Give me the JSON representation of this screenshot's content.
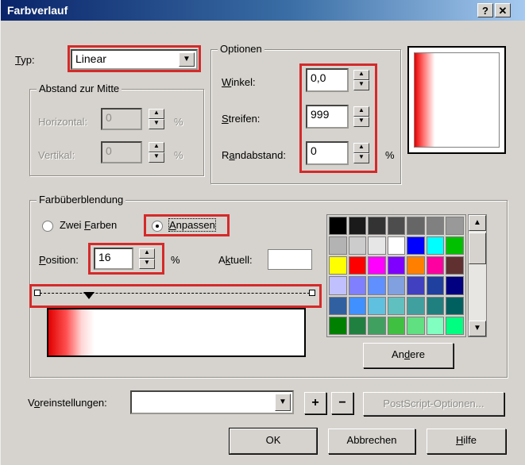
{
  "window": {
    "title": "Farbverlauf",
    "help_label": "?",
    "close_label": "✕"
  },
  "typ": {
    "label_pre": "",
    "label_u": "T",
    "label_post": "yp:",
    "value": "Linear"
  },
  "abstand": {
    "title": "Abstand zur Mitte",
    "horizontal": {
      "label": "Horizontal:",
      "value": "0",
      "unit": "%"
    },
    "vertikal": {
      "label": "Vertikal:",
      "value": "0",
      "unit": "%"
    }
  },
  "optionen": {
    "title": "Optionen",
    "winkel": {
      "label_u": "W",
      "label_post": "inkel:",
      "value": "0,0"
    },
    "streifen": {
      "label_u": "S",
      "label_post": "treifen:",
      "value": "999"
    },
    "randabstand": {
      "label_pre": "R",
      "label_u": "a",
      "label_post": "ndabstand:",
      "value": "0",
      "unit": "%"
    }
  },
  "farb": {
    "title": "Farbüberblendung",
    "zwei_pre": "Zwei ",
    "zwei_u": "F",
    "zwei_post": "arben",
    "anpassen_u": "A",
    "anpassen_post": "npassen",
    "position_u": "P",
    "position_post": "osition:",
    "position_value": "16",
    "position_unit": "%",
    "aktuell_pre": "A",
    "aktuell_u": "k",
    "aktuell_post": "tuell:",
    "andere_pre": "An",
    "andere_u": "d",
    "andere_post": "ere"
  },
  "palette": [
    "#000000",
    "#1a1a1a",
    "#333333",
    "#4d4d4d",
    "#666666",
    "#808080",
    "#999999",
    "#b3b3b3",
    "#cccccc",
    "#e6e6e6",
    "#ffffff",
    "#0000ff",
    "#00ffff",
    "#00c000",
    "#ffff00",
    "#ff0000",
    "#ff00ff",
    "#8000ff",
    "#ff8000",
    "#ff00a0",
    "#603030",
    "#c0c0ff",
    "#8080ff",
    "#6090ff",
    "#80a0e0",
    "#4040c0",
    "#2040a0",
    "#000080",
    "#3060a0",
    "#4090ff",
    "#60c0e0",
    "#60c0c0",
    "#40a0a0",
    "#208080",
    "#006060",
    "#008000",
    "#208040",
    "#40a060",
    "#40c040",
    "#60e080",
    "#80ffc0",
    "#00ff80"
  ],
  "voreinstellungen": {
    "label_pre": "V",
    "label_u": "o",
    "label_post": "reinstellungen:",
    "value": "",
    "plus": "+",
    "minus": "−",
    "postscript": "PostScript-Optionen..."
  },
  "buttons": {
    "ok": "OK",
    "abbrechen": "Abbrechen",
    "hilfe_u": "H",
    "hilfe_post": "ilfe"
  }
}
